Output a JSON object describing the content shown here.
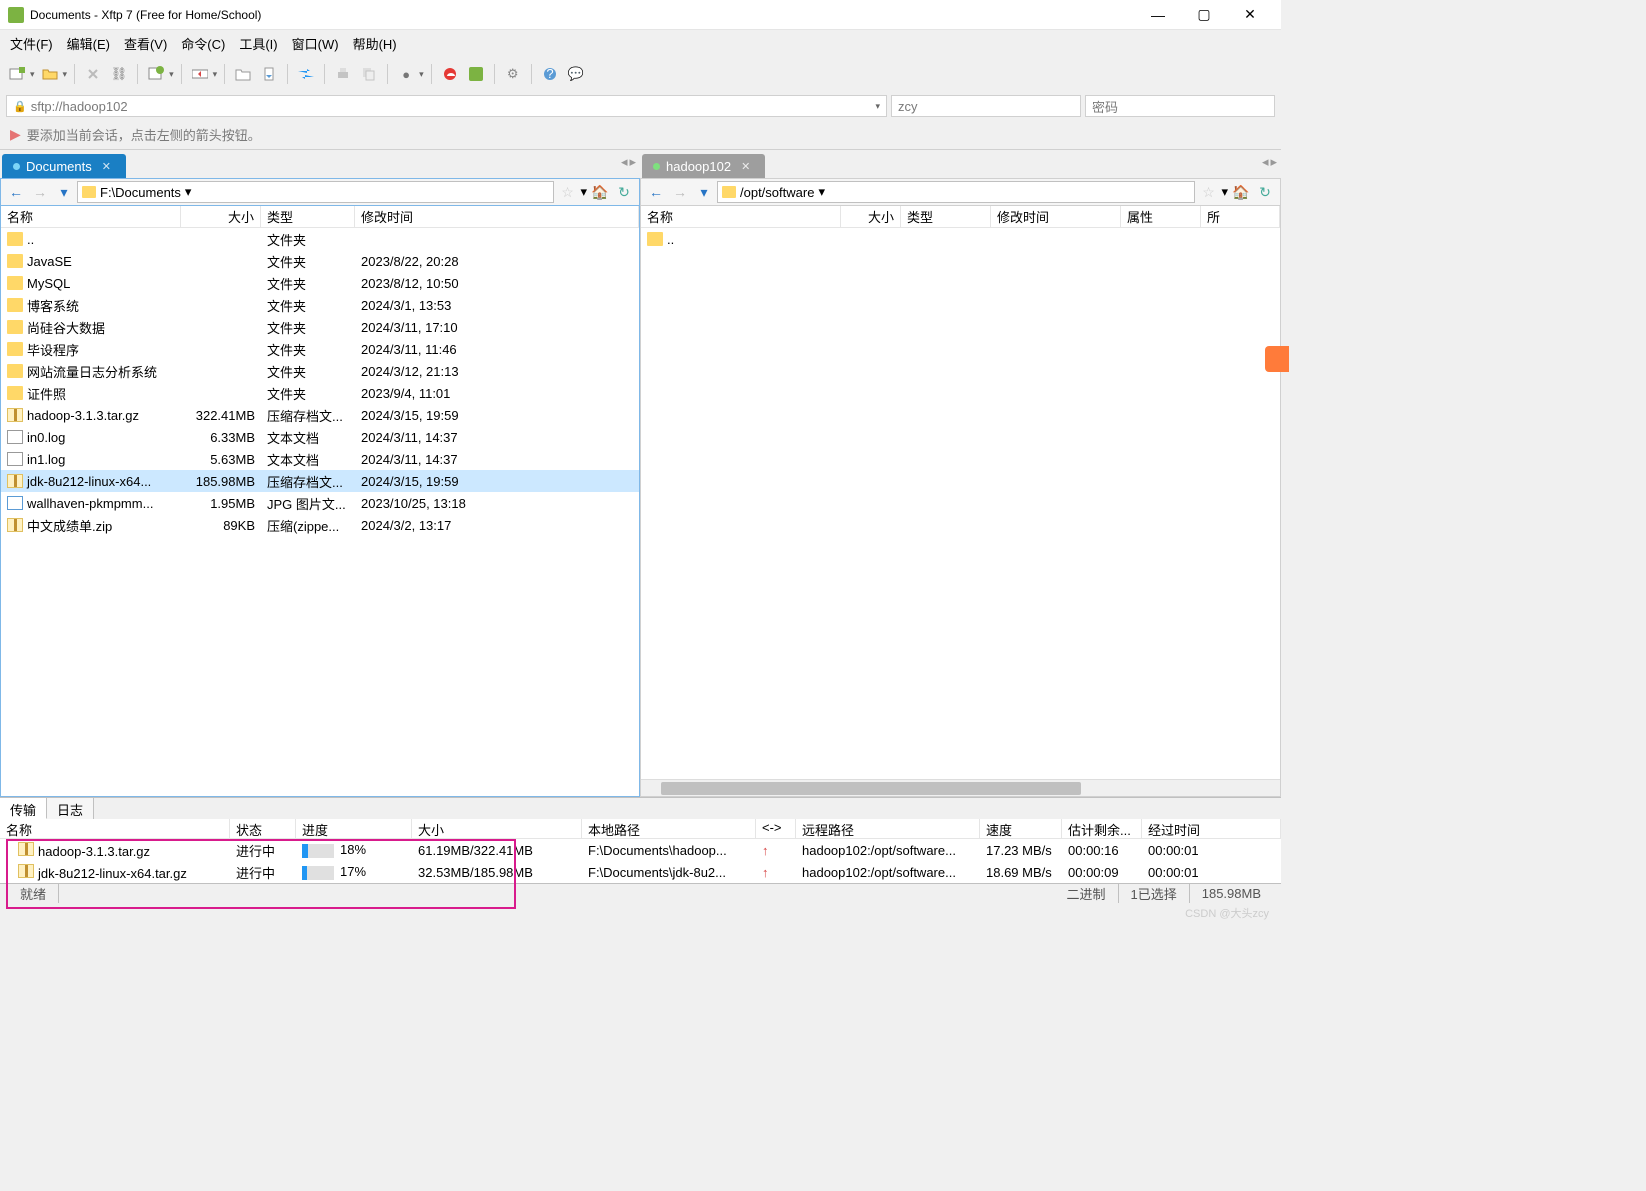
{
  "window": {
    "title": "Documents - Xftp 7 (Free for Home/School)"
  },
  "menubar": {
    "file": "文件(F)",
    "edit": "编辑(E)",
    "view": "查看(V)",
    "command": "命令(C)",
    "tools": "工具(I)",
    "window": "窗口(W)",
    "help": "帮助(H)"
  },
  "addressbar": {
    "url": "sftp://hadoop102",
    "user": "zcy",
    "pwd_placeholder": "密码"
  },
  "hint": {
    "text": "要添加当前会话，点击左侧的箭头按钮。"
  },
  "left": {
    "tab": "Documents",
    "path": "F:\\Documents",
    "cols": {
      "name": "名称",
      "size": "大小",
      "type": "类型",
      "modified": "修改时间"
    },
    "rows": [
      {
        "icon": "folder",
        "name": "..",
        "size": "",
        "type": "文件夹",
        "mod": ""
      },
      {
        "icon": "folder",
        "name": "JavaSE",
        "size": "",
        "type": "文件夹",
        "mod": "2023/8/22, 20:28"
      },
      {
        "icon": "folder",
        "name": "MySQL",
        "size": "",
        "type": "文件夹",
        "mod": "2023/8/12, 10:50"
      },
      {
        "icon": "folder",
        "name": "博客系统",
        "size": "",
        "type": "文件夹",
        "mod": "2024/3/1, 13:53"
      },
      {
        "icon": "folder",
        "name": "尚硅谷大数据",
        "size": "",
        "type": "文件夹",
        "mod": "2024/3/11, 17:10"
      },
      {
        "icon": "folder",
        "name": "毕设程序",
        "size": "",
        "type": "文件夹",
        "mod": "2024/3/11, 11:46"
      },
      {
        "icon": "folder",
        "name": "网站流量日志分析系统",
        "size": "",
        "type": "文件夹",
        "mod": "2024/3/12, 21:13"
      },
      {
        "icon": "folder",
        "name": "证件照",
        "size": "",
        "type": "文件夹",
        "mod": "2023/9/4, 11:01"
      },
      {
        "icon": "archive",
        "name": "hadoop-3.1.3.tar.gz",
        "size": "322.41MB",
        "type": "压缩存档文...",
        "mod": "2024/3/15, 19:59"
      },
      {
        "icon": "text",
        "name": "in0.log",
        "size": "6.33MB",
        "type": "文本文档",
        "mod": "2024/3/11, 14:37"
      },
      {
        "icon": "text",
        "name": "in1.log",
        "size": "5.63MB",
        "type": "文本文档",
        "mod": "2024/3/11, 14:37"
      },
      {
        "icon": "archive",
        "name": "jdk-8u212-linux-x64...",
        "size": "185.98MB",
        "type": "压缩存档文...",
        "mod": "2024/3/15, 19:59",
        "selected": true
      },
      {
        "icon": "image",
        "name": "wallhaven-pkmpmm...",
        "size": "1.95MB",
        "type": "JPG 图片文...",
        "mod": "2023/10/25, 13:18"
      },
      {
        "icon": "archive",
        "name": "中文成绩单.zip",
        "size": "89KB",
        "type": "压缩(zippe...",
        "mod": "2024/3/2, 13:17"
      }
    ]
  },
  "right": {
    "tab": "hadoop102",
    "path": "/opt/software",
    "cols": {
      "name": "名称",
      "size": "大小",
      "type": "类型",
      "modified": "修改时间",
      "attr": "属性",
      "owner": "所"
    },
    "rows": [
      {
        "icon": "folder",
        "name": "..",
        "size": "",
        "type": "",
        "mod": ""
      }
    ]
  },
  "bottom_tabs": {
    "transfer": "传输",
    "log": "日志"
  },
  "transfer": {
    "cols": {
      "name": "名称",
      "status": "状态",
      "progress": "进度",
      "size": "大小",
      "local": "本地路径",
      "dir": "<->",
      "remote": "远程路径",
      "speed": "速度",
      "eta": "估计剩余...",
      "elapsed": "经过时间"
    },
    "rows": [
      {
        "name": "hadoop-3.1.3.tar.gz",
        "status": "进行中",
        "progress": 18,
        "progress_txt": "18%",
        "size": "61.19MB/322.41MB",
        "local": "F:\\Documents\\hadoop...",
        "remote": "hadoop102:/opt/software...",
        "speed": "17.23 MB/s",
        "eta": "00:00:16",
        "elapsed": "00:00:01"
      },
      {
        "name": "jdk-8u212-linux-x64.tar.gz",
        "status": "进行中",
        "progress": 17,
        "progress_txt": "17%",
        "size": "32.53MB/185.98MB",
        "local": "F:\\Documents\\jdk-8u2...",
        "remote": "hadoop102:/opt/software...",
        "speed": "18.69 MB/s",
        "eta": "00:00:09",
        "elapsed": "00:00:01"
      }
    ]
  },
  "statusbar": {
    "ready": "就绪",
    "binary": "二进制",
    "selected": "1已选择",
    "size": "185.98MB"
  },
  "watermark": "CSDN @大头zcy"
}
